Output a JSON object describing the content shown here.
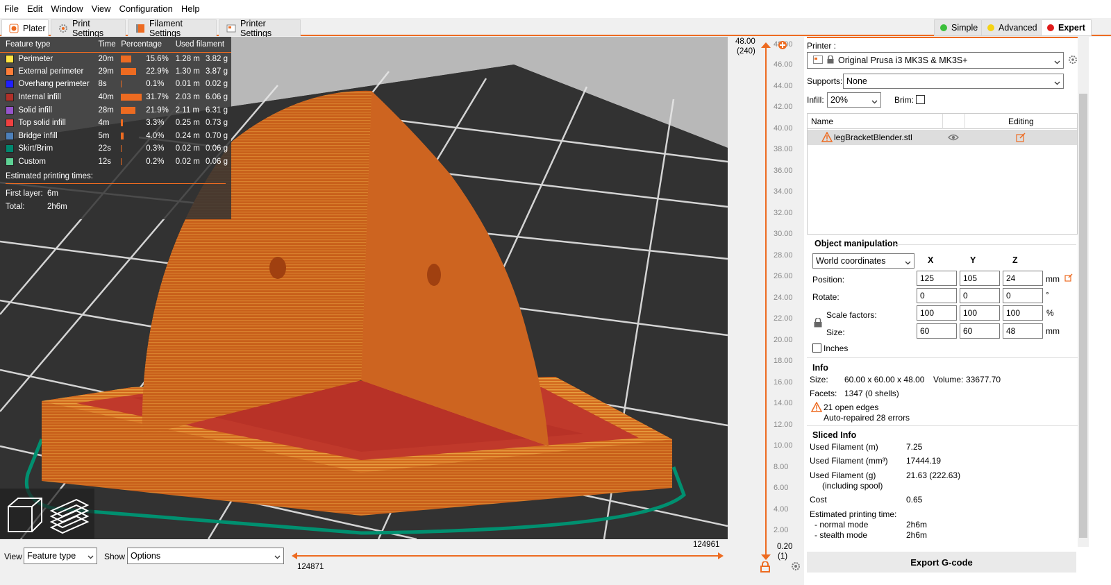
{
  "menu": [
    "File",
    "Edit",
    "Window",
    "View",
    "Configuration",
    "Help"
  ],
  "tabs": [
    {
      "label": "Plater",
      "icon": "plater-icon"
    },
    {
      "label": "Print Settings",
      "icon": "gear-icon"
    },
    {
      "label": "Filament Settings",
      "icon": "spool-icon"
    },
    {
      "label": "Printer Settings",
      "icon": "printer-icon"
    }
  ],
  "modes": [
    {
      "label": "Simple",
      "color": "#3bbf3b"
    },
    {
      "label": "Advanced",
      "color": "#f5d314"
    },
    {
      "label": "Expert",
      "color": "#e01b1b"
    }
  ],
  "legend": {
    "headers": [
      "Feature type",
      "Time",
      "Percentage",
      "Used filament"
    ],
    "rows": [
      {
        "name": "Perimeter",
        "color": "#ffe540",
        "time": "20m",
        "pct_value": 15.6,
        "pct": "15.6%",
        "length": "1.28 m",
        "weight": "3.82 g"
      },
      {
        "name": "External perimeter",
        "color": "#ff7d38",
        "time": "29m",
        "pct_value": 22.9,
        "pct": "22.9%",
        "length": "1.30 m",
        "weight": "3.87 g"
      },
      {
        "name": "Overhang perimeter",
        "color": "#1f1fff",
        "time": "8s",
        "pct_value": 0.1,
        "pct": "0.1%",
        "length": "0.01 m",
        "weight": "0.02 g"
      },
      {
        "name": "Internal infill",
        "color": "#b03029",
        "time": "40m",
        "pct_value": 31.7,
        "pct": "31.7%",
        "length": "2.03 m",
        "weight": "6.06 g"
      },
      {
        "name": "Solid infill",
        "color": "#9654cc",
        "time": "28m",
        "pct_value": 21.9,
        "pct": "21.9%",
        "length": "2.11 m",
        "weight": "6.31 g"
      },
      {
        "name": "Top solid infill",
        "color": "#f04040",
        "time": "4m",
        "pct_value": 3.3,
        "pct": "3.3%",
        "length": "0.25 m",
        "weight": "0.73 g"
      },
      {
        "name": "Bridge infill",
        "color": "#4d80ba",
        "time": "5m",
        "pct_value": 4.0,
        "pct": "4.0%",
        "length": "0.24 m",
        "weight": "0.70 g"
      },
      {
        "name": "Skirt/Brim",
        "color": "#00876e",
        "time": "22s",
        "pct_value": 0.3,
        "pct": "0.3%",
        "length": "0.02 m",
        "weight": "0.06 g"
      },
      {
        "name": "Custom",
        "color": "#5ed194",
        "time": "12s",
        "pct_value": 0.2,
        "pct": "0.2%",
        "length": "0.02 m",
        "weight": "0.06 g"
      }
    ],
    "times_title": "Estimated printing times:",
    "first_layer_label": "First layer:",
    "first_layer": "6m",
    "total_label": "Total:",
    "total": "2h6m"
  },
  "bottom": {
    "view_label": "View",
    "view_value": "Feature type",
    "show_label": "Show",
    "show_value": "Options",
    "h_slider_right": "124961",
    "h_slider_left": "124871"
  },
  "vslider": {
    "top_value": "48.00",
    "top_layer": "(240)",
    "bottom_value": "0.20",
    "bottom_layer": "(1)",
    "ticks": [
      "46.00",
      "44.00",
      "42.00",
      "40.00",
      "38.00",
      "36.00",
      "34.00",
      "32.00",
      "30.00",
      "28.00",
      "26.00",
      "24.00",
      "22.00",
      "20.00",
      "18.00",
      "16.00",
      "14.00",
      "12.00",
      "10.00",
      "8.00",
      "6.00",
      "4.00",
      "2.00"
    ],
    "top_tick": "48.00"
  },
  "panel": {
    "printer_label": "Printer :",
    "printer_value": "Original Prusa i3 MK3S & MK3S+",
    "supports_label": "Supports:",
    "supports_value": "None",
    "infill_label": "Infill:",
    "infill_value": "20%",
    "brim_label": "Brim:",
    "col_name": "Name",
    "col_editing": "Editing",
    "object_name": "legBracketBlender.stl",
    "om_title": "Object manipulation",
    "coords_value": "World coordinates",
    "axis_x": "X",
    "axis_y": "Y",
    "axis_z": "Z",
    "position_label": "Position:",
    "position": [
      "125",
      "105",
      "24"
    ],
    "position_unit": "mm",
    "rotate_label": "Rotate:",
    "rotate": [
      "0",
      "0",
      "0"
    ],
    "rotate_unit": "°",
    "scale_label": "Scale factors:",
    "scale": [
      "100",
      "100",
      "100"
    ],
    "scale_unit": "%",
    "size_label": "Size:",
    "size": [
      "60",
      "60",
      "48"
    ],
    "size_unit": "mm",
    "inches_label": "Inches",
    "info_title": "Info",
    "info_size_label": "Size:",
    "info_size": "60.00 x 60.00 x 48.00",
    "info_volume_label": "Volume:",
    "info_volume": "33677.70",
    "info_facets_label": "Facets:",
    "info_facets": "1347 (0 shells)",
    "info_open_edges": "21 open edges",
    "info_repaired": "Auto-repaired 28 errors",
    "sliced_title": "Sliced Info",
    "sliced": [
      {
        "label": "Used Filament (m)",
        "value": "7.25"
      },
      {
        "label": "Used Filament (mm³)",
        "value": "17444.19"
      },
      {
        "label": "Used Filament (g)",
        "value": "21.63 (222.63)"
      },
      {
        "label": "Cost",
        "value": "0.65"
      }
    ],
    "including_spool": "(including spool)",
    "est_title": "Estimated printing time:",
    "normal_mode_label": "- normal mode",
    "normal_mode": "2h6m",
    "stealth_mode_label": "- stealth mode",
    "stealth_mode": "2h6m",
    "export_label": "Export G-code"
  }
}
